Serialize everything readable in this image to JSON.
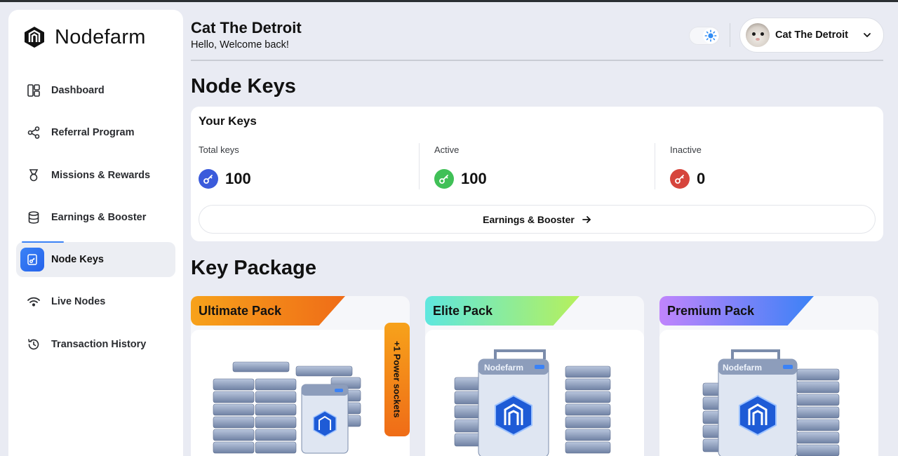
{
  "app": {
    "name": "Nodefarm"
  },
  "sidebar": {
    "items": [
      {
        "label": "Dashboard",
        "icon": "dashboard-icon"
      },
      {
        "label": "Referral Program",
        "icon": "share-icon"
      },
      {
        "label": "Missions & Rewards",
        "icon": "medal-icon"
      },
      {
        "label": "Earnings & Booster",
        "icon": "database-icon"
      },
      {
        "label": "Node Keys",
        "icon": "key-document-icon",
        "active": true
      },
      {
        "label": "Live Nodes",
        "icon": "wifi-icon"
      },
      {
        "label": "Transaction History",
        "icon": "history-icon"
      }
    ]
  },
  "header": {
    "title": "Cat The Detroit",
    "subtitle": "Hello, Welcome back!",
    "theme_icon": "sun-icon",
    "user": {
      "name": "Cat The Detroit"
    }
  },
  "page": {
    "title": "Node Keys"
  },
  "keys": {
    "card_title": "Your Keys",
    "total": {
      "label": "Total keys",
      "value": "100",
      "color": "#3b5bdb"
    },
    "active": {
      "label": "Active",
      "value": "100",
      "color": "#40c057"
    },
    "inactive": {
      "label": "Inactive",
      "value": "0",
      "color": "#d6453d"
    },
    "button_label": "Earnings & Booster"
  },
  "packages": {
    "title": "Key Package",
    "items": [
      {
        "name": "Ultimate Pack",
        "badge": "+1 Power sockets",
        "gradient": [
          "#f7a21b",
          "#ef6c17"
        ]
      },
      {
        "name": "Elite Pack",
        "gradient": [
          "#5ee7df",
          "#b6f05c"
        ]
      },
      {
        "name": "Premium Pack",
        "gradient": [
          "#c084fc",
          "#3b82f6"
        ]
      }
    ],
    "box_label": "Nodefarm"
  }
}
